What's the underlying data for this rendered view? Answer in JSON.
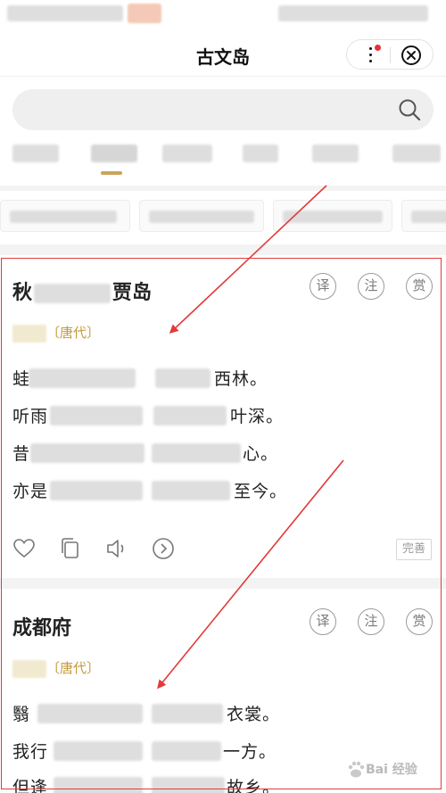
{
  "header": {
    "title": "古文岛"
  },
  "search": {
    "placeholder": ""
  },
  "poems": [
    {
      "title": "秋寄…贾岛",
      "title_start": "秋",
      "title_end": "贾岛",
      "dynasty": "〔唐代〕",
      "buttons": [
        "译",
        "注",
        "赏"
      ],
      "lines": [
        {
          "start": "蛙",
          "end": "西林。"
        },
        {
          "start": "听雨",
          "end": "叶深。"
        },
        {
          "start": "昔",
          "end": "心。"
        },
        {
          "start": "亦是",
          "end": "至今。"
        }
      ],
      "perfect_label": "完善"
    },
    {
      "title": "成都府",
      "dynasty": "〔唐代〕",
      "buttons": [
        "译",
        "注",
        "赏"
      ],
      "lines": [
        {
          "start": "翳",
          "end": "衣裳。"
        },
        {
          "start": "我行",
          "end": "一方。"
        },
        {
          "start": "但逢",
          "end": "故乡。"
        }
      ]
    }
  ],
  "annotation": {
    "color": "#e23a3a"
  },
  "watermark": {
    "text": "Bai 经验"
  },
  "colors": {
    "accent": "#c8a45a",
    "dynasty": "#c49a3a",
    "badge_dot": "#e8303a"
  }
}
